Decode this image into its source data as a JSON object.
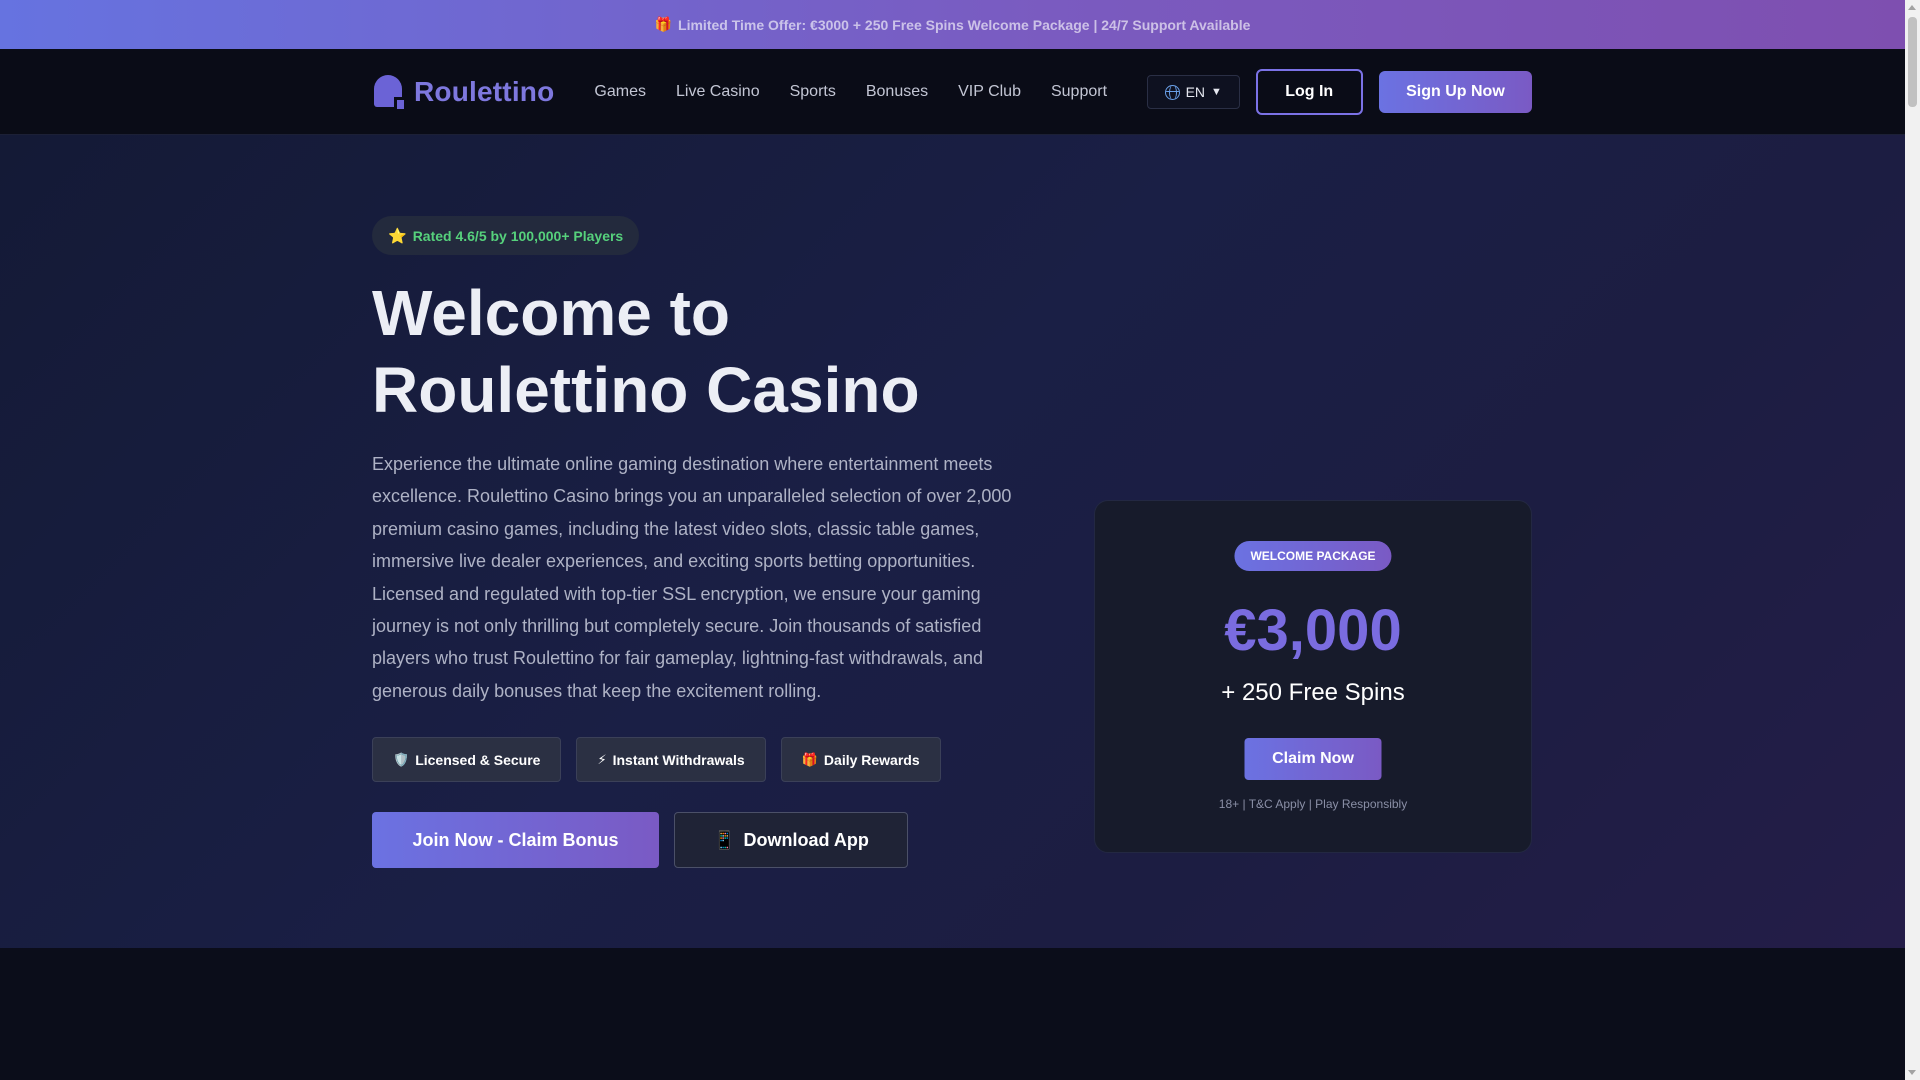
{
  "promo": {
    "icon": "gift-icon",
    "gift_glyph": "🎁",
    "text": "Limited Time Offer: €3000 + 250 Free Spins Welcome Package | 24/7 Support Available"
  },
  "header": {
    "logo_icon": "casino-dome-icon",
    "logo_text": "Roulettino",
    "nav": [
      "Games",
      "Live Casino",
      "Sports",
      "Bonuses",
      "VIP Club",
      "Support"
    ],
    "language": {
      "icon": "globe-icon",
      "value": "EN",
      "caret": "▼"
    },
    "login_label": "Log In",
    "signup_label": "Sign Up Now"
  },
  "hero": {
    "rating": {
      "icon": "star-icon",
      "star_glyph": "⭐",
      "text": "Rated 4.6/5 by 100,000+ Players"
    },
    "title_line1": "Welcome to",
    "title_line2": "Roulettino Casino",
    "description": "Experience the ultimate online gaming destination where entertainment meets excellence. Roulettino Casino brings you an unparalleled selection of over 2,000 premium casino games, including the latest video slots, classic table games, immersive live dealer experiences, and exciting sports betting opportunities. Licensed and regulated with top-tier SSL encryption, we ensure your gaming journey is not only thrilling but completely secure. Join thousands of satisfied players who trust Roulettino for fair gameplay, lightning-fast withdrawals, and generous daily bonuses that keep the excitement rolling.",
    "features": [
      {
        "icon": "shield-icon",
        "glyph": "🛡️",
        "label": "Licensed & Secure"
      },
      {
        "icon": "lightning-icon",
        "glyph": "⚡",
        "label": "Instant Withdrawals"
      },
      {
        "icon": "gift-icon",
        "glyph": "🎁",
        "label": "Daily Rewards"
      }
    ],
    "join_label": "Join Now - Claim Bonus",
    "app": {
      "icon": "phone-icon",
      "glyph": "📱",
      "label": "Download App"
    }
  },
  "welcome_card": {
    "badge": "WELCOME PACKAGE",
    "amount": "€3,000",
    "spins": "+ 250 Free Spins",
    "claim_label": "Claim Now",
    "terms": "18+ | T&C Apply | Play Responsibly"
  },
  "colors": {
    "accent": "#6b72e2",
    "accent_2": "#7a5ac4",
    "rating_green": "#56d17c",
    "amount_purple": "#7a6ce0"
  }
}
